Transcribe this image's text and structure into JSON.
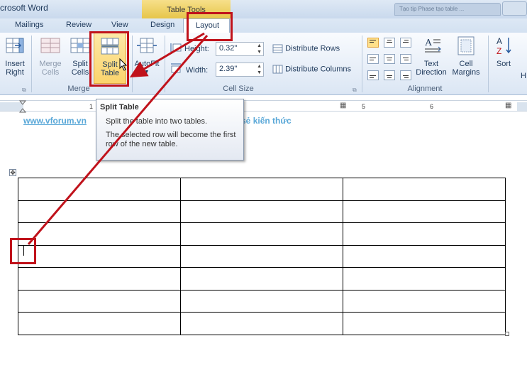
{
  "window": {
    "title": "crosoft Word",
    "contextual_tab_group": "Table Tools",
    "background_tab_text": "Tạo tip Phase tạo table ..."
  },
  "tabs": [
    "Mailings",
    "Review",
    "View",
    "Design",
    "Layout"
  ],
  "ribbon": {
    "insert_right": {
      "line1": "Insert",
      "line2": "Right"
    },
    "merge_cells": {
      "line1": "Merge",
      "line2": "Cells"
    },
    "split_cells": {
      "line1": "Split",
      "line2": "Cells"
    },
    "split_table": {
      "line1": "Split",
      "line2": "Table"
    },
    "autofit": {
      "label": "AutoFit"
    },
    "height": {
      "label": "Height:",
      "value": "0.32\""
    },
    "width": {
      "label": "Width:",
      "value": "2.39\""
    },
    "distribute_rows": "Distribute Rows",
    "distribute_columns": "Distribute Columns",
    "text_direction": {
      "line1": "Text",
      "line2": "Direction"
    },
    "cell_margins": {
      "line1": "Cell",
      "line2": "Margins"
    },
    "sort": "Sort",
    "groups": {
      "merge": "Merge",
      "cell_size": "Cell Size",
      "alignment": "Alignment"
    }
  },
  "ruler": {
    "marks": [
      "1",
      "5",
      "6"
    ]
  },
  "tooltip": {
    "title": "Split Table",
    "line1": "Split the table into two tables.",
    "line2": "The selected row will become the first row of the new table."
  },
  "document": {
    "watermark_left": "www.vforum.vn",
    "watermark_right": "a sẻ kiến thức",
    "table": {
      "rows": 7,
      "cols": 3
    }
  },
  "colors": {
    "annotation_red": "#c0121b",
    "selected_yellow": "#ffe08a",
    "watermark_blue": "#5aa8d8"
  }
}
